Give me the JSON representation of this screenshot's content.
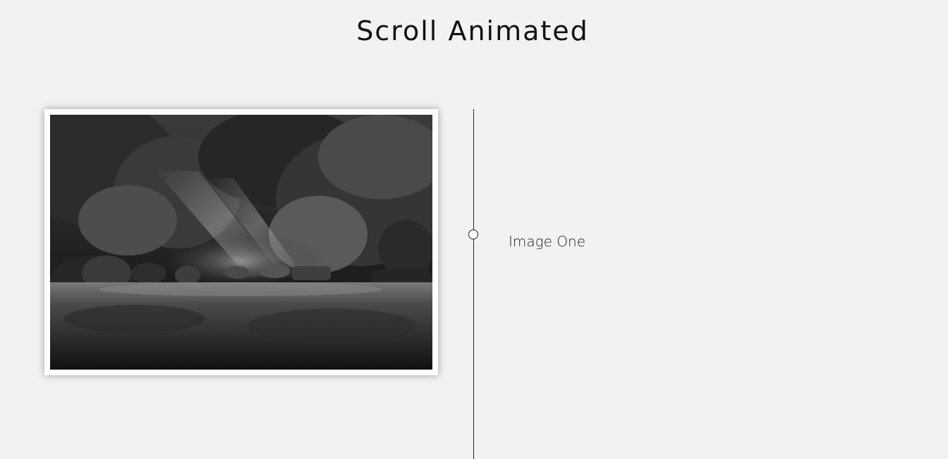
{
  "page": {
    "title": "Scroll Animated"
  },
  "timeline": {
    "items": [
      {
        "caption": "Image One",
        "image_icon": "forest-pond-photo"
      }
    ]
  }
}
